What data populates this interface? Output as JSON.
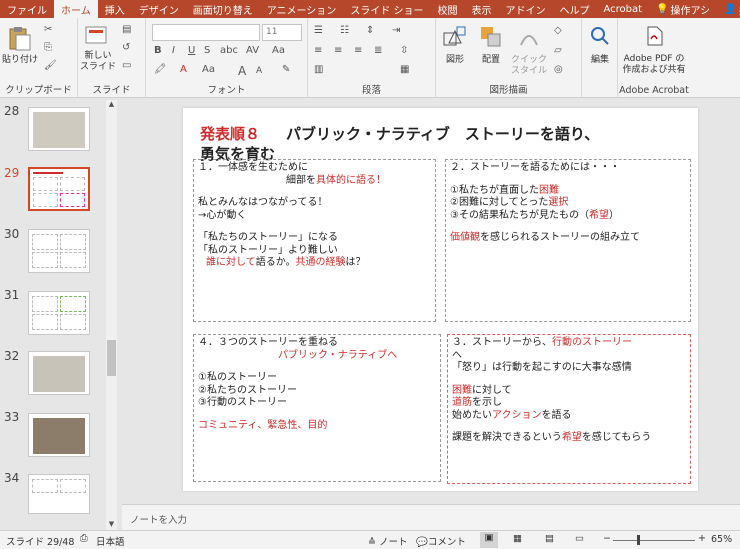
{
  "tabs": [
    "ファイル",
    "ホーム",
    "挿入",
    "デザイン",
    "画面切り替え",
    "アニメーション",
    "スライド ショー",
    "校閲",
    "表示",
    "アドイン",
    "ヘルプ",
    "Acrobat",
    "操作アシ",
    "共"
  ],
  "ribbon": {
    "clipboard": {
      "label": "クリップボード",
      "paste": "貼り付け"
    },
    "slides": {
      "label": "スライド",
      "new_slide_1": "新しい",
      "new_slide_2": "スライド"
    },
    "font": {
      "label": "フォント",
      "size": "11",
      "size_up": "A",
      "size_down": "A",
      "clear": "Aa"
    },
    "paragraph": {
      "label": "段落"
    },
    "drawing": {
      "label": "図形描画",
      "shapes": "図形",
      "arrange": "配置",
      "quick_1": "クイック",
      "quick_2": "スタイル"
    },
    "edit": {
      "label": "編集"
    },
    "acrobat": {
      "label": "Adobe Acrobat",
      "btn_1": "Adobe PDF の",
      "btn_2": "作成および共有"
    }
  },
  "thumbnails": [
    "28",
    "29",
    "30",
    "31",
    "32",
    "33",
    "34"
  ],
  "slide": {
    "title_red": "発表順８",
    "title_black": "パブリック・ナラティブ　ストーリーを語り、",
    "title_line2": "勇気を育む",
    "box1": {
      "l1": "１．一体感を生むために",
      "l2a": "細部を",
      "l2b": "具体的に語る！",
      "l3": "私とみんなはつながってる！",
      "l4": "→心が動く",
      "l5": "「私たちのストーリー」になる",
      "l6": "「私のストーリー」より難しい",
      "l7a": "誰に対して",
      "l7b": "語るか。",
      "l7c": "共通の経験",
      "l7d": "は？"
    },
    "box2": {
      "l1": "２．ストーリーを語るためには・・・",
      "l2a": "①私たちが直面した",
      "l2b": "困難",
      "l3a": "②困難に対してとった",
      "l3b": "選択",
      "l4a": "③その結果私たちが見たもの（",
      "l4b": "希望",
      "l4c": "）",
      "l5a": "価値観",
      "l5b": "を感じられるストーリーの組み立て"
    },
    "box3": {
      "l1": "４．３つのストーリーを重ねる",
      "l2": "パブリック・ナラティブへ",
      "l3": "①私のストーリー",
      "l4": "②私たちのストーリー",
      "l5": "③行動のストーリー",
      "l6": "コミュニティ、緊急性、目的"
    },
    "box4": {
      "l1a": "３．ストーリーから、",
      "l1b": "行動のストーリー",
      "l2": "へ",
      "l3": "「怒り」は行動を起こすのに大事な感情",
      "l4a": "困難",
      "l4b": "に対して",
      "l5a": "道筋",
      "l5b": "を示し",
      "l6a": "始めたい",
      "l6b": "アクション",
      "l6c": "を語る",
      "l7a": "課題を解決できるという",
      "l7b": "希望",
      "l7c": "を感じてもらう"
    }
  },
  "notes_placeholder": "ノートを入力",
  "status": {
    "slide": "スライド 29/48",
    "lang": "日本語",
    "notes": "ノート",
    "comments": "コメント",
    "zoom": "65%"
  },
  "accent": "#b7472a"
}
